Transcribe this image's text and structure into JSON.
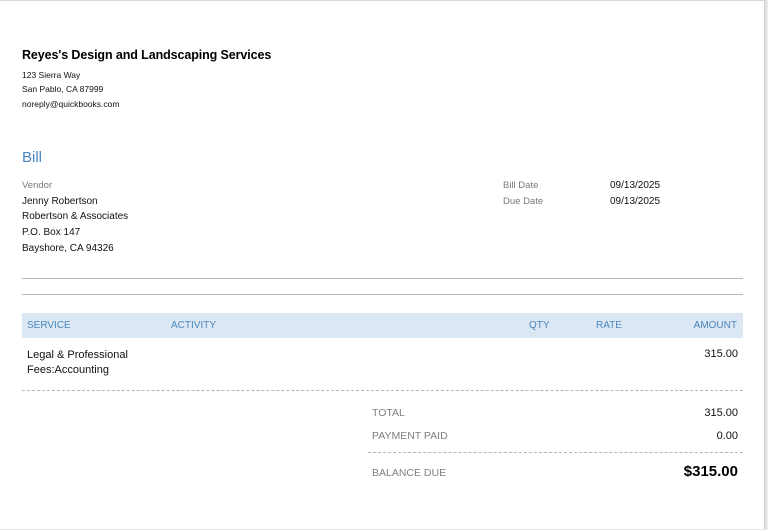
{
  "company": {
    "name": "Reyes's Design and Landscaping Services",
    "address_line1": "123 Sierra Way",
    "address_line2": "San Pablo, CA  87999",
    "email": "noreply@quickbooks.com"
  },
  "document": {
    "title": "Bill"
  },
  "vendor": {
    "label": "Vendor",
    "name": "Jenny Robertson",
    "company": "Robertson & Associates",
    "street": "P.O. Box 147",
    "city": "Bayshore, CA 94326"
  },
  "meta": {
    "bill_date_label": "Bill Date",
    "bill_date": "09/13/2025",
    "due_date_label": "Due Date",
    "due_date": "09/13/2025"
  },
  "table": {
    "headers": {
      "service": "SERVICE",
      "activity": "ACTIVITY",
      "qty": "QTY",
      "rate": "RATE",
      "amount": "AMOUNT"
    },
    "rows": [
      {
        "service": "Legal & Professional Fees:Accounting",
        "activity": "",
        "qty": "",
        "rate": "",
        "amount": "315.00"
      }
    ]
  },
  "summary": {
    "total_label": "TOTAL",
    "total": "315.00",
    "payment_label": "PAYMENT PAID",
    "payment": "0.00",
    "balance_label": "BALANCE DUE",
    "balance": "$315.00"
  },
  "colors": {
    "accent": "#4a87bf",
    "header_bg": "#dbe7f2",
    "muted_text": "#7a7a7a"
  }
}
